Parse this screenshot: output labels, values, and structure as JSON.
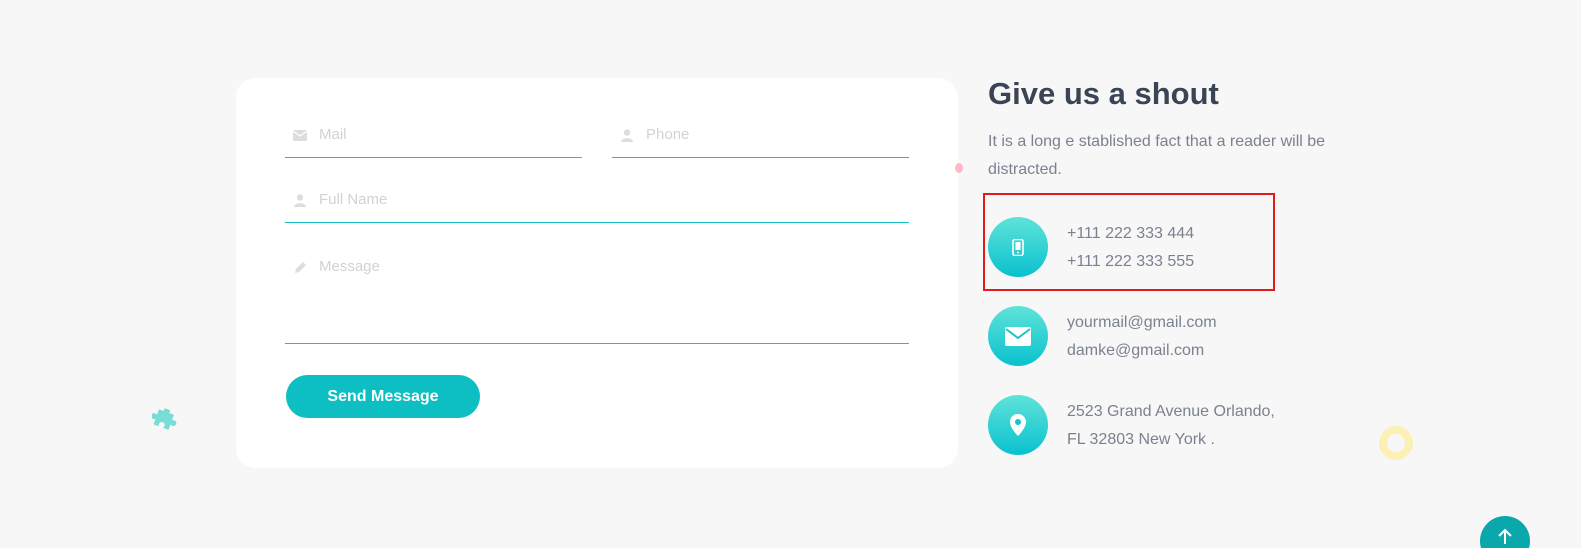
{
  "form": {
    "mail_placeholder": "Mail",
    "phone_placeholder": "Phone",
    "fullname_placeholder": "Full Name",
    "message_placeholder": "Message",
    "send_label": "Send Message"
  },
  "contact": {
    "title": "Give us a shout",
    "intro": "It is a long e stablished fact that a reader will be distracted.",
    "phone": {
      "icon": "mobile-phone-icon",
      "line1": "+111 222 333 444",
      "line2": "+111 222 333 555"
    },
    "email": {
      "icon": "envelope-icon",
      "line1": "yourmail@gmail.com",
      "line2": "damke@gmail.com"
    },
    "address": {
      "icon": "map-pin-icon",
      "line1": "2523 Grand Avenue Orlando,",
      "line2": "FL 32803 New York ."
    }
  },
  "colors": {
    "accent": "#0dbfc2",
    "title": "#3b4454",
    "body_text": "#7b8190",
    "highlight_box": "#e41b1b",
    "background": "#f7f7f7"
  }
}
